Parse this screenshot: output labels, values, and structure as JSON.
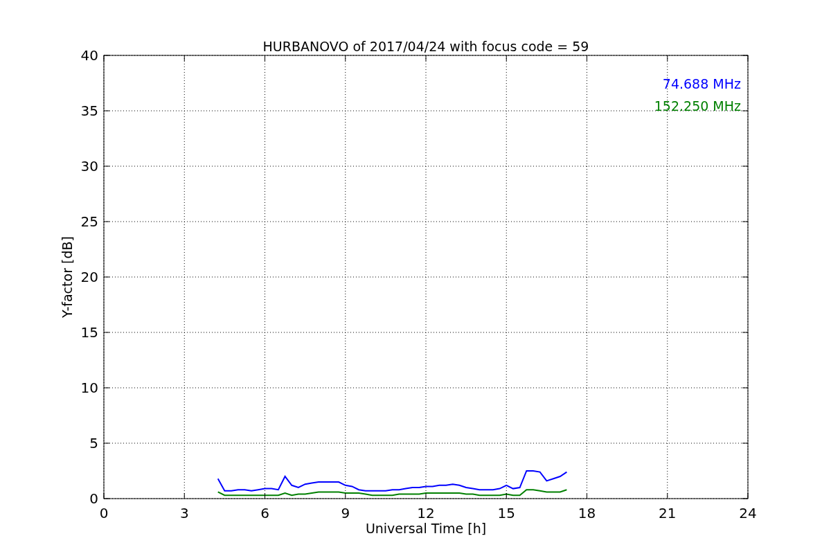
{
  "chart_data": {
    "type": "line",
    "title": "HURBANOVO of 2017/04/24 with focus code = 59",
    "xlabel": "Universal Time [h]",
    "ylabel": "Y-factor [dB]",
    "x": [
      4.25,
      4.5,
      4.75,
      5,
      5.25,
      5.5,
      5.75,
      6,
      6.25,
      6.5,
      6.75,
      7,
      7.25,
      7.5,
      7.75,
      8,
      8.25,
      8.5,
      8.75,
      9,
      9.25,
      9.5,
      9.75,
      10,
      10.25,
      10.5,
      10.75,
      11,
      11.25,
      11.5,
      11.75,
      12,
      12.25,
      12.5,
      12.75,
      13,
      13.25,
      13.5,
      13.75,
      14,
      14.25,
      14.5,
      14.75,
      15,
      15.25,
      15.5,
      15.75,
      16,
      16.25,
      16.5,
      16.75,
      17,
      17.25
    ],
    "series": [
      {
        "name": "74.688 MHz",
        "color": "#0000ff",
        "values": [
          1.8,
          0.7,
          0.7,
          0.8,
          0.8,
          0.7,
          0.8,
          0.9,
          0.9,
          0.8,
          2.0,
          1.2,
          1.0,
          1.3,
          1.4,
          1.5,
          1.5,
          1.5,
          1.5,
          1.2,
          1.1,
          0.8,
          0.7,
          0.7,
          0.7,
          0.7,
          0.8,
          0.8,
          0.9,
          1.0,
          1.0,
          1.1,
          1.1,
          1.2,
          1.2,
          1.3,
          1.2,
          1.0,
          0.9,
          0.8,
          0.8,
          0.8,
          0.9,
          1.2,
          0.9,
          1.0,
          2.5,
          2.5,
          2.4,
          1.6,
          1.8,
          2.0,
          2.4
        ]
      },
      {
        "name": "152.250 MHz",
        "color": "#008000",
        "values": [
          0.6,
          0.3,
          0.3,
          0.3,
          0.3,
          0.3,
          0.3,
          0.3,
          0.3,
          0.3,
          0.5,
          0.3,
          0.4,
          0.4,
          0.5,
          0.6,
          0.6,
          0.6,
          0.6,
          0.5,
          0.5,
          0.5,
          0.4,
          0.3,
          0.3,
          0.3,
          0.3,
          0.4,
          0.4,
          0.4,
          0.4,
          0.5,
          0.5,
          0.5,
          0.5,
          0.5,
          0.5,
          0.4,
          0.4,
          0.3,
          0.3,
          0.3,
          0.3,
          0.4,
          0.3,
          0.3,
          0.8,
          0.8,
          0.7,
          0.6,
          0.6,
          0.6,
          0.8
        ]
      }
    ],
    "xlim": [
      0,
      24
    ],
    "ylim": [
      0,
      40
    ],
    "xticks": [
      0,
      3,
      6,
      9,
      12,
      15,
      18,
      21,
      24
    ],
    "yticks": [
      0,
      5,
      10,
      15,
      20,
      25,
      30,
      35,
      40
    ],
    "grid": true
  }
}
